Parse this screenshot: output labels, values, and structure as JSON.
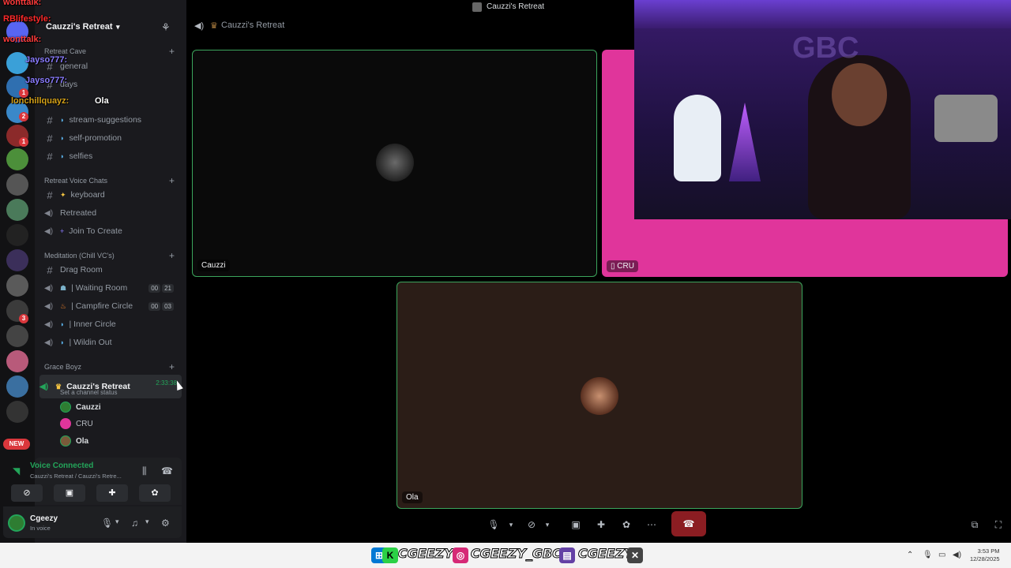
{
  "window": {
    "title": "Cauzzi's Retreat"
  },
  "server": {
    "name": "Cauzzi's Retreat"
  },
  "categories": {
    "cave": "Retreat Cave",
    "voice": "Retreat Voice Chats",
    "meditation": "Meditation (Chill VC's)",
    "grace": "Grace Boyz"
  },
  "channels_text": [
    {
      "name": "general"
    },
    {
      "name": "days"
    },
    {
      "name": "stream-suggestions"
    },
    {
      "name": "self-promotion"
    },
    {
      "name": "selfies"
    }
  ],
  "channels_voice": [
    {
      "name": "keyboard"
    },
    {
      "name": "Retreated"
    },
    {
      "name": "Join To Create"
    }
  ],
  "channels_meditation": [
    {
      "name": "Drag Room"
    },
    {
      "name": "| Waiting Room",
      "counts": [
        "00",
        "21"
      ]
    },
    {
      "name": "| Campfire Circle",
      "counts": [
        "00",
        "03"
      ]
    },
    {
      "name": "| Inner Circle"
    },
    {
      "name": "| Wildin Out"
    }
  ],
  "active_channel": {
    "name": "Cauzzi's Retreat",
    "timer": "2:33:38",
    "status_prompt": "Set a channel status"
  },
  "members": [
    "Cauzzi",
    "CRU",
    "Ola"
  ],
  "voice_panel": {
    "title": "Voice Connected",
    "subtitle": "Cauzzi's Retreat / Cauzzi's Retre..."
  },
  "user": {
    "name": "Cgeezy",
    "status": "In voice"
  },
  "stage": {
    "header": "Cauzzi's Retreat",
    "tiles": [
      "Cauzzi",
      "CRU",
      "Ola"
    ]
  },
  "rail": {
    "new_label": "NEW"
  },
  "overlay_chat": [
    {
      "user": "wonttalk:",
      "color": "#ff3b3b"
    },
    {
      "user": "RBlifestyle:",
      "color": "#ff2a2a"
    },
    {
      "user": "wonttalk:",
      "color": "#ff3b3b"
    },
    {
      "user": "Jayso777:",
      "color": "#8a7bff"
    },
    {
      "user": "Jayso777:",
      "color": "#8a7bff"
    },
    {
      "user": "lonchillquayz:",
      "color": "#d4a017",
      "msg": "Ola"
    }
  ],
  "taskbar": {
    "brand": [
      "CGEEZY",
      "CGEEZY_GBC",
      "CGEEZY"
    ],
    "time": "3:53 PM",
    "date": "12/28/2025"
  },
  "colors": {
    "accent_green": "#23a55a",
    "tile_border": "#3ba55c",
    "cru_bg": "#e0359b",
    "ola_bg": "#2b1d17"
  }
}
